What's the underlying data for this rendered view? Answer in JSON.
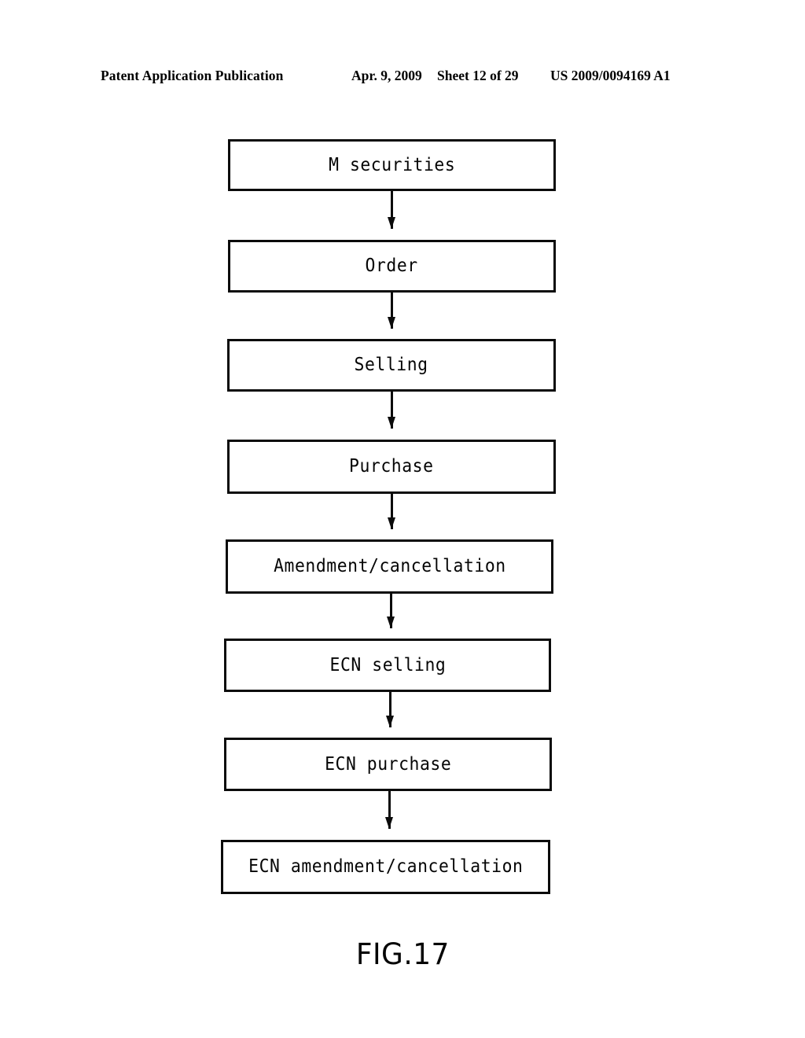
{
  "header": {
    "publication": "Patent Application Publication",
    "date": "Apr. 9, 2009",
    "sheet": "Sheet 12 of 29",
    "patent_number": "US 2009/0094169 A1"
  },
  "figure": {
    "caption": "FIG.17"
  },
  "colors": {
    "ink": "#0b0b0b",
    "paper": "#ffffff"
  },
  "flowchart": {
    "type": "vertical-sequence",
    "boxes": [
      {
        "id": "box-0",
        "label": "M securities"
      },
      {
        "id": "box-1",
        "label": "Order"
      },
      {
        "id": "box-2",
        "label": "Selling"
      },
      {
        "id": "box-3",
        "label": "Purchase"
      },
      {
        "id": "box-4",
        "label": "Amendment/cancellation"
      },
      {
        "id": "box-5",
        "label": "ECN selling"
      },
      {
        "id": "box-6",
        "label": "ECN purchase"
      },
      {
        "id": "box-7",
        "label": "ECN amendment/cancellation"
      }
    ],
    "connectors": [
      {
        "from": "box-0",
        "to": "box-1",
        "arrow": "down"
      },
      {
        "from": "box-1",
        "to": "box-2",
        "arrow": "down"
      },
      {
        "from": "box-2",
        "to": "box-3",
        "arrow": "down"
      },
      {
        "from": "box-3",
        "to": "box-4",
        "arrow": "down"
      },
      {
        "from": "box-4",
        "to": "box-5",
        "arrow": "down"
      },
      {
        "from": "box-5",
        "to": "box-6",
        "arrow": "down"
      },
      {
        "from": "box-6",
        "to": "box-7",
        "arrow": "down"
      }
    ]
  }
}
